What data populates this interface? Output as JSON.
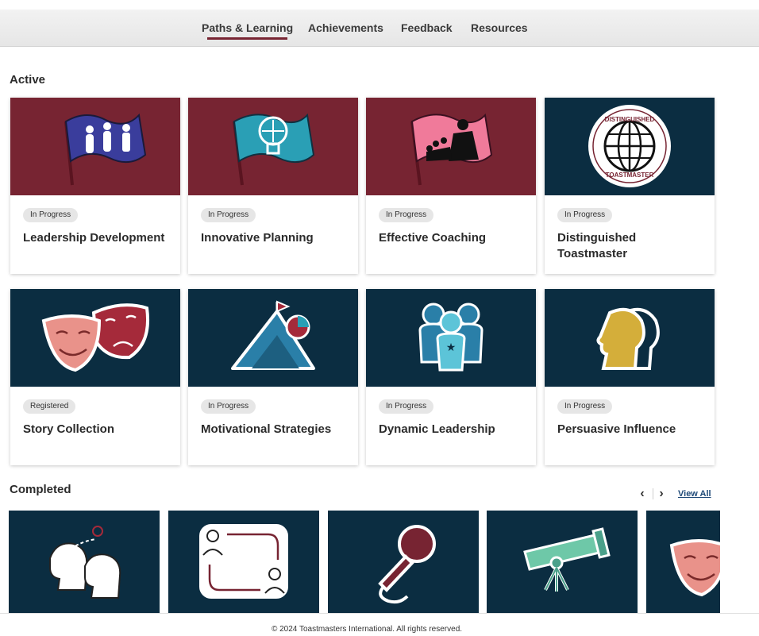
{
  "nav": {
    "tabs": [
      {
        "label": "Paths & Learning",
        "active": true
      },
      {
        "label": "Achievements"
      },
      {
        "label": "Feedback"
      },
      {
        "label": "Resources"
      }
    ]
  },
  "colors": {
    "maroon": "#772432",
    "navy": "#0b2d41",
    "accent_teal": "#2a9fb5",
    "pink": "#e9928a"
  },
  "active": {
    "title": "Active",
    "cards": [
      {
        "title": "Leadership Development",
        "status": "In Progress",
        "icon": "flag-team-icon"
      },
      {
        "title": "Innovative Planning",
        "status": "In Progress",
        "icon": "flag-lightbulb-icon"
      },
      {
        "title": "Effective Coaching",
        "status": "In Progress",
        "icon": "flag-speaker-icon"
      },
      {
        "title": "Distinguished Toastmaster",
        "status": "In Progress",
        "icon": "globe-seal-icon",
        "seal_text_top": "DISTINGUISHED",
        "seal_text_bottom": "TOASTMASTER"
      },
      {
        "title": "Story Collection",
        "status": "Registered",
        "icon": "theater-masks-icon"
      },
      {
        "title": "Motivational Strategies",
        "status": "In Progress",
        "icon": "mountain-flag-icon"
      },
      {
        "title": "Dynamic Leadership",
        "status": "In Progress",
        "icon": "people-star-icon"
      },
      {
        "title": "Persuasive Influence",
        "status": "In Progress",
        "icon": "two-heads-icon"
      }
    ]
  },
  "completed": {
    "title": "Completed",
    "view_all": "View All",
    "prev_label": "‹",
    "next_label": "›",
    "cards": [
      {
        "icon": "two-heads-location-icon"
      },
      {
        "icon": "exchange-people-icon"
      },
      {
        "icon": "microphone-icon"
      },
      {
        "icon": "telescope-icon"
      },
      {
        "icon": "theater-mask-icon"
      }
    ]
  },
  "footer": {
    "text": "© 2024 Toastmasters International. All rights reserved."
  }
}
